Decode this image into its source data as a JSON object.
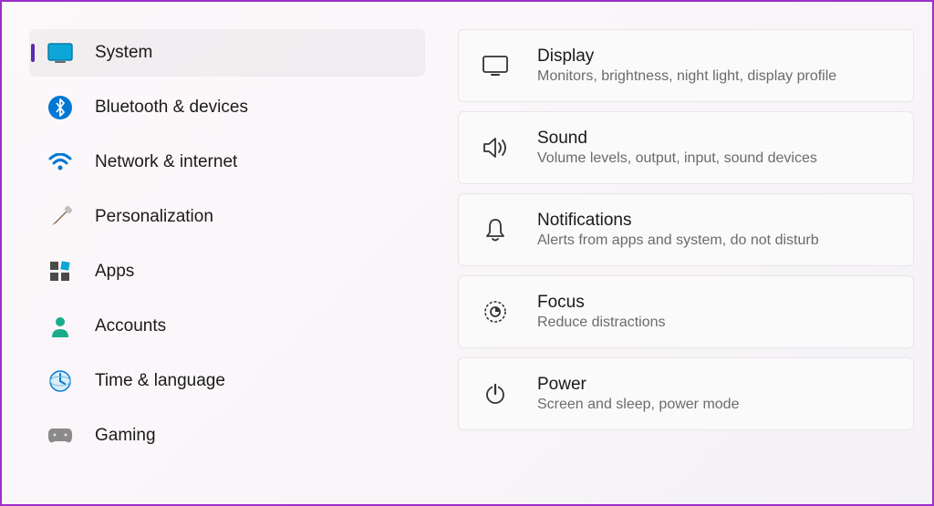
{
  "sidebar": {
    "items": [
      {
        "label": "System",
        "active": true
      },
      {
        "label": "Bluetooth & devices",
        "active": false
      },
      {
        "label": "Network & internet",
        "active": false
      },
      {
        "label": "Personalization",
        "active": false
      },
      {
        "label": "Apps",
        "active": false
      },
      {
        "label": "Accounts",
        "active": false
      },
      {
        "label": "Time & language",
        "active": false
      },
      {
        "label": "Gaming",
        "active": false
      }
    ]
  },
  "cards": [
    {
      "title": "Display",
      "desc": "Monitors, brightness, night light, display profile"
    },
    {
      "title": "Sound",
      "desc": "Volume levels, output, input, sound devices"
    },
    {
      "title": "Notifications",
      "desc": "Alerts from apps and system, do not disturb"
    },
    {
      "title": "Focus",
      "desc": "Reduce distractions"
    },
    {
      "title": "Power",
      "desc": "Screen and sleep, power mode"
    }
  ],
  "annotation": {
    "arrow_color": "#8b2fd1"
  }
}
